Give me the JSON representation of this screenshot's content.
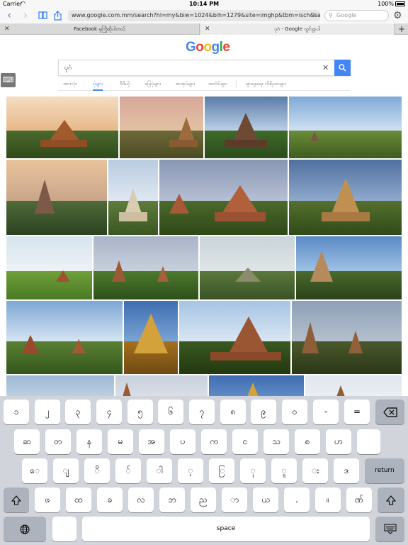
{
  "status_bar": {
    "carrier": "Carrier",
    "time": "10:14 PM",
    "battery": "100%",
    "wifi_icon": "wifi-icon",
    "battery_icon": "battery-icon"
  },
  "toolbar": {
    "url": "www.google.com.mm/search?hl=my&biw=1024&bih=1279&site=imghp&tbm=isch&sa=1&ei...",
    "search_placeholder": "Google",
    "icons": [
      "back-icon",
      "forward-icon",
      "bookmarks-icon",
      "share-icon",
      "reload-icon",
      "search-icon",
      "gear-icon"
    ]
  },
  "tabs": [
    {
      "title": "Facebook မှကြိုဆိုပါတယ်"
    },
    {
      "title": "ပုဂံ - Google ထွင်ရှာပါ"
    }
  ],
  "google": {
    "logo": {
      "letters": [
        "G",
        "o",
        "o",
        "g",
        "l",
        "e"
      ],
      "colors": [
        "#4285f4",
        "#ea4335",
        "#fbbc05",
        "#4285f4",
        "#34a853",
        "#ea4335"
      ]
    },
    "query": "ပုဂံ",
    "search_tabs": [
      "အားလုံး",
      "ပုံများ",
      "ဗီဒီယို",
      "မြေပုံများ",
      "စာအုပ်များ",
      "အက်ပ်များ",
      "ရှာဖွေရေး ကိရိယာများ"
    ],
    "active_tab_index": 1,
    "accent": "#4285f4"
  },
  "keyboard": {
    "row1": [
      "၁",
      "၂",
      "၃",
      "၄",
      "၅",
      "၆",
      "၇",
      "၈",
      "၉",
      "၀",
      "-",
      "="
    ],
    "row2": [
      "ဆ",
      "တ",
      "န",
      "မ",
      "အ",
      "ပ",
      "က",
      "င",
      "သ",
      "စ",
      "ဟ",
      ""
    ],
    "row3": [
      "ေ",
      "ျ",
      "ိ",
      "်",
      "ါ",
      "့",
      "ြ",
      "ု",
      "ူ",
      "း",
      "ဒ"
    ],
    "row4": [
      "ဖ",
      "ထ",
      "ခ",
      "လ",
      "ဘ",
      "ည",
      "ာ",
      "ယ",
      ".",
      "။",
      "ဏ်"
    ],
    "return_label": "return",
    "space_label": "space",
    "icons": [
      "backspace-icon",
      "shift-icon",
      "globe-icon",
      "keyboard-dismiss-icon"
    ]
  }
}
